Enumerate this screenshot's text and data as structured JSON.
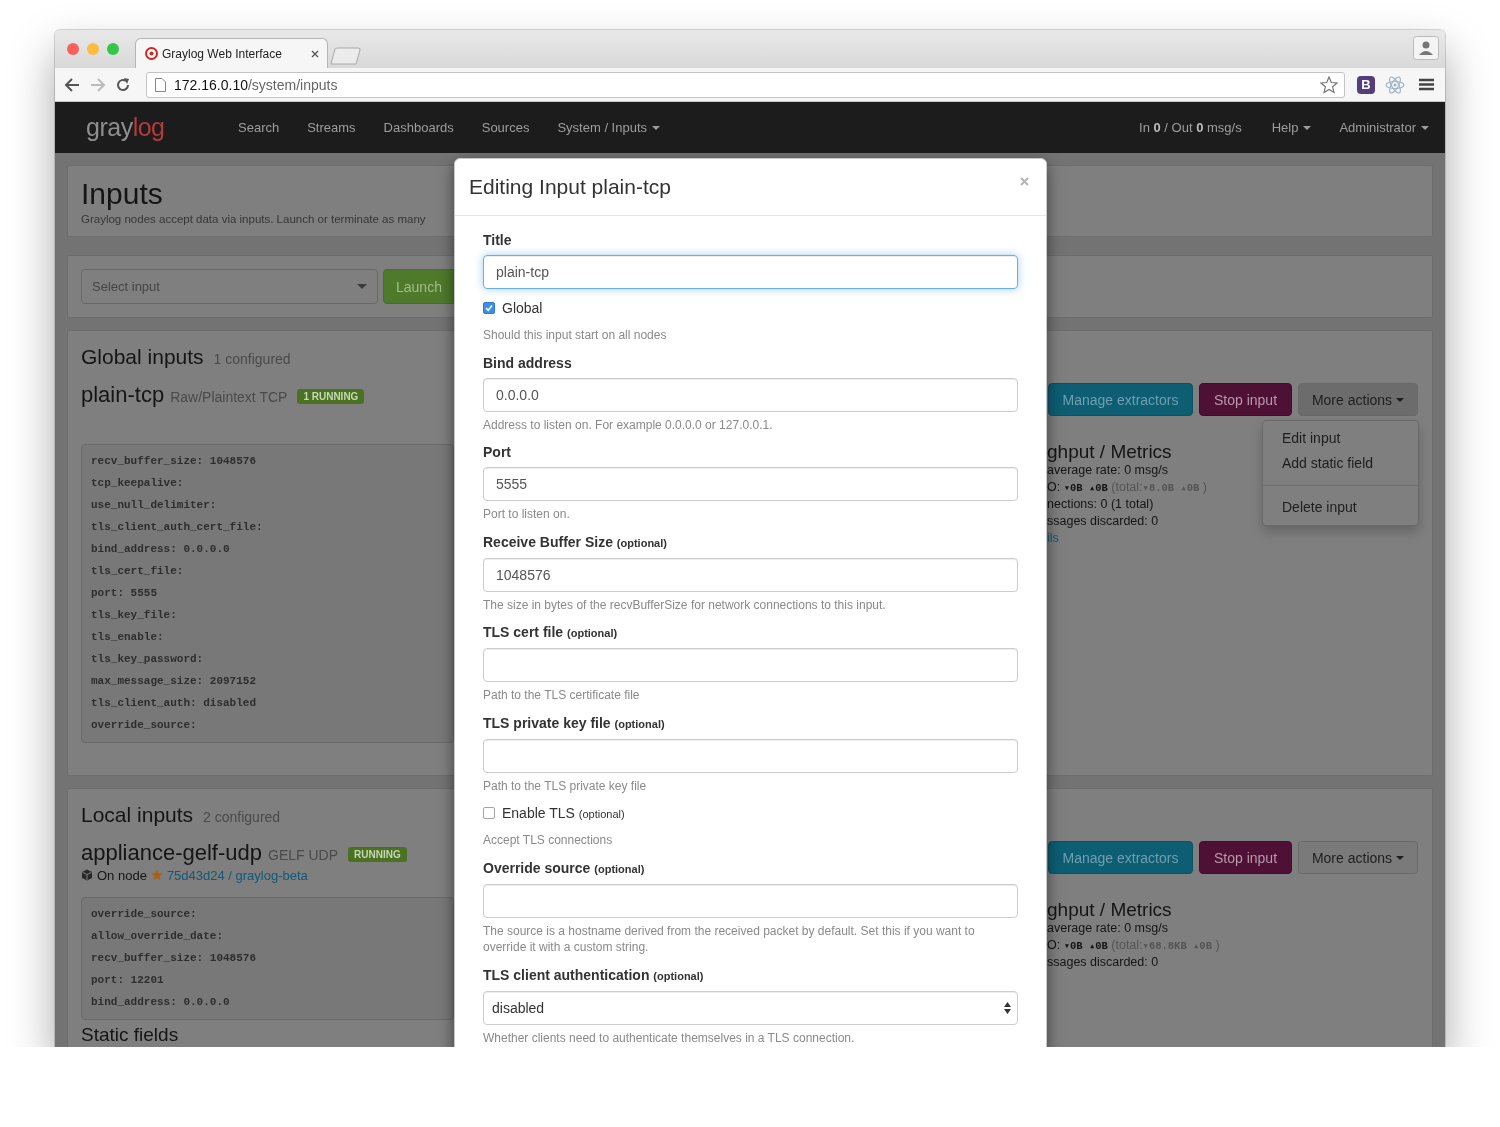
{
  "browser": {
    "tab_title": "Graylog Web Interface",
    "url_host": "172.16.0.10",
    "url_path": "/system/inputs",
    "extension_letter": "B"
  },
  "navbar": {
    "logo": {
      "text": "gray",
      "accent": "log"
    },
    "items": [
      {
        "label": "Search",
        "dropdown": false
      },
      {
        "label": "Streams",
        "dropdown": false
      },
      {
        "label": "Dashboards",
        "dropdown": false
      },
      {
        "label": "Sources",
        "dropdown": false
      },
      {
        "label": "System / Inputs",
        "dropdown": true
      }
    ],
    "throughput": "In **0** / Out **0** msg/s",
    "right_items": [
      {
        "label": "Help",
        "dropdown": true
      },
      {
        "label": "Administrator",
        "dropdown": true
      }
    ]
  },
  "page": {
    "title": "Inputs",
    "subtitle": "Graylog nodes accept data via inputs. Launch or terminate as many",
    "select_placeholder": "Select input",
    "launch_button": "Launch"
  },
  "sections": [
    {
      "heading": "Global inputs",
      "count": "1 configured",
      "inputs": [
        {
          "name": "plain-tcp",
          "type": "Raw/Plaintext TCP",
          "badge": "1 RUNNING",
          "config": [
            "recv_buffer_size: 1048576",
            "tcp_keepalive:",
            "use_null_delimiter:",
            "tls_client_auth_cert_file:",
            "bind_address: 0.0.0.0",
            "tls_cert_file:",
            "port: 5555",
            "tls_key_file:",
            "tls_enable:",
            "tls_key_password:",
            "max_message_size: 2097152",
            "tls_client_auth: disabled",
            "override_source:"
          ],
          "actions": [
            "Manage extractors",
            "Stop input"
          ],
          "more_actions": "More actions",
          "menu_open": true,
          "menu": [
            [
              "Edit input",
              "Add static field"
            ],
            [
              "Delete input"
            ]
          ],
          "metrics_title": "ghput / Metrics",
          "metrics": [
            {
              "kind": "text",
              "text": "average rate: 0 msg/s"
            },
            {
              "kind": "io",
              "label": "O:",
              "values": "▾0B ▴0B",
              "total_label": "(total:",
              "total_values": "▾8.0B ▴0B",
              "close": ")"
            },
            {
              "kind": "text",
              "text": "nections: 0 (1 total)"
            },
            {
              "kind": "text",
              "text": "ssages discarded: 0"
            },
            {
              "kind": "link",
              "text": "ils"
            }
          ]
        }
      ]
    },
    {
      "heading": "Local inputs",
      "count": "2 configured",
      "inputs": [
        {
          "name": "appliance-gelf-udp",
          "type": "GELF UDP",
          "badge": "RUNNING",
          "node": {
            "label": "On node",
            "link": "75d43d24 / graylog-beta"
          },
          "config": [
            "override_source:",
            "allow_override_date:",
            "recv_buffer_size: 1048576",
            "port: 12201",
            "bind_address: 0.0.0.0"
          ],
          "static_fields_heading": "Static fields",
          "actions": [
            "Manage extractors",
            "Stop input"
          ],
          "more_actions": "More actions",
          "menu_open": false,
          "metrics_title": "ghput / Metrics",
          "metrics": [
            {
              "kind": "text",
              "text": "average rate: 0 msg/s"
            },
            {
              "kind": "io",
              "label": "O:",
              "values": "▾0B ▴0B",
              "total_label": "(total:",
              "total_values": "▾68.8KB ▴0B",
              "close": ")"
            },
            {
              "kind": "text",
              "text": "ssages discarded: 0"
            }
          ]
        }
      ]
    }
  ],
  "modal": {
    "title": "Editing Input plain-tcp",
    "fields": [
      {
        "kind": "text",
        "label": "Title",
        "value": "plain-tcp",
        "focused": true
      },
      {
        "kind": "checkbox",
        "label": "Global",
        "checked": true,
        "help": "Should this input start on all nodes"
      },
      {
        "kind": "text",
        "label": "Bind address",
        "value": "0.0.0.0",
        "focused": false,
        "help": "Address to listen on. For example 0.0.0.0 or 127.0.0.1."
      },
      {
        "kind": "text",
        "label": "Port",
        "value": "5555",
        "focused": false,
        "help": "Port to listen on."
      },
      {
        "kind": "text",
        "label": "Receive Buffer Size",
        "optional": "(optional)",
        "value": "1048576",
        "focused": false,
        "help": "The size in bytes of the recvBufferSize for network connections to this input."
      },
      {
        "kind": "text",
        "label": "TLS cert file",
        "optional": "(optional)",
        "focused": false,
        "help": "Path to the TLS certificate file"
      },
      {
        "kind": "text",
        "label": "TLS private key file",
        "optional": "(optional)",
        "focused": false,
        "help": "Path to the TLS private key file"
      },
      {
        "kind": "checkbox",
        "label": "Enable TLS",
        "optional": "(optional)",
        "checked": false,
        "help": "Accept TLS connections"
      },
      {
        "kind": "text",
        "label": "Override source",
        "optional": "(optional)",
        "focused": false,
        "help": "The source is a hostname derived from the received packet by default. Set this if you want to override it with a custom string."
      },
      {
        "kind": "select",
        "label": "TLS client authentication",
        "optional": "(optional)",
        "value": "disabled",
        "help": "Whether clients need to authenticate themselves in a TLS connection."
      }
    ]
  }
}
